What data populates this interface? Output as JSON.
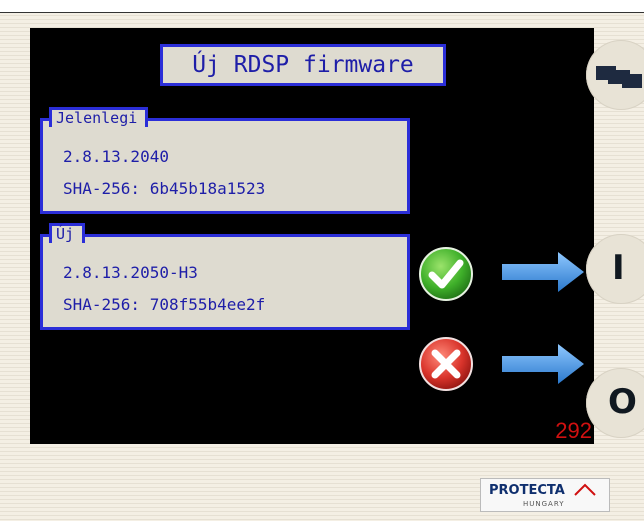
{
  "title": "Új RDSP firmware",
  "current": {
    "label": "Jelenlegi",
    "version": "2.8.13.2040",
    "sha": "SHA-256: 6b45b18a1523"
  },
  "new_fw": {
    "label": "Új",
    "version": "2.8.13.2050-H3",
    "sha": "SHA-256: 708f55b4ee2f"
  },
  "counter": "292",
  "side_buttons": {
    "top_icon": "screens-icon",
    "i_label": "I",
    "o_label": "O"
  },
  "actions": {
    "confirm_icon": "check-icon",
    "cancel_icon": "x-icon",
    "arrow_icon": "arrow-right-icon"
  },
  "logo": {
    "name": "PROTECTA",
    "sub": "HUNGARY"
  },
  "colors": {
    "panel_border": "#2b2ed8",
    "panel_bg": "#dedbd0",
    "text": "#1e1ea8",
    "counter": "#d01010",
    "confirm": "#3fb02a",
    "cancel": "#d9342b",
    "arrow": "#3b8fe0"
  }
}
